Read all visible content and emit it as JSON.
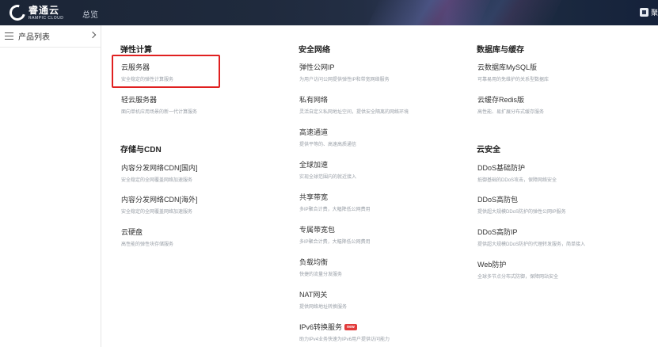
{
  "header": {
    "logo_cn": "睿通云",
    "logo_en": "RAMPIC CLOUD",
    "nav_overview": "总览",
    "user_fragment": "聚"
  },
  "sidebar": {
    "title": "产品列表"
  },
  "columns": [
    {
      "groups": [
        {
          "title": "弹性计算",
          "items": [
            {
              "name": "云服务器",
              "desc": "安全稳定的弹性计算服务"
            },
            {
              "name": "轻云服务器",
              "desc": "面向单机应用场景的新一代计算服务"
            }
          ]
        },
        {
          "title": "存储与CDN",
          "items": [
            {
              "name": "内容分发网络CDN[国内]",
              "desc": "安全稳定的全网覆盖网络加速服务"
            },
            {
              "name": "内容分发网络CDN[海外]",
              "desc": "安全稳定的全网覆盖网络加速服务"
            },
            {
              "name": "云硬盘",
              "desc": "高性能的弹性块存储服务"
            }
          ]
        }
      ]
    },
    {
      "groups": [
        {
          "title": "安全网络",
          "items": [
            {
              "name": "弹性公网IP",
              "desc": "为用户访问公网提供弹性IP和带宽网络服务"
            },
            {
              "name": "私有网络",
              "desc": "灵活自定义私网地址空间，提供安全隔离的网络环境"
            },
            {
              "name": "高速通道",
              "desc": "提供平等的、高速高质通信"
            },
            {
              "name": "全球加速",
              "desc": "实现全球范围内的就近接入"
            },
            {
              "name": "共享带宽",
              "desc": "多IP聚合计费，大幅降低公网费用"
            },
            {
              "name": "专属带宽包",
              "desc": "多IP聚合计费，大幅降低公网费用"
            },
            {
              "name": "负载均衡",
              "desc": "快捷的流量分发服务"
            },
            {
              "name": "NAT网关",
              "desc": "提供网络地址转换服务"
            },
            {
              "name": "IPv6转换服务",
              "desc": "助力IPv4业务快速为IPv6用户提供访问能力",
              "badge": "new"
            }
          ]
        }
      ]
    },
    {
      "groups": [
        {
          "title": "数据库与缓存",
          "items": [
            {
              "name": "云数据库MySQL版",
              "desc": "可靠易用的免维护的关系型数据库"
            },
            {
              "name": "云缓存Redis版",
              "desc": "高性能、易扩展分布式缓存服务"
            }
          ]
        },
        {
          "title": "云安全",
          "items": [
            {
              "name": "DDoS基础防护",
              "desc": "抵御基础的DDoS攻击，保障网络安全"
            },
            {
              "name": "DDoS高防包",
              "desc": "提供超大规模DDoS防护的弹性公网IP服务"
            },
            {
              "name": "DDoS高防IP",
              "desc": "提供超大规模DDoS防护的代理转发服务，简单接入"
            },
            {
              "name": "Web防护",
              "desc": "全球多节点分布式防御，保障网站安全"
            }
          ]
        }
      ]
    }
  ],
  "colors": {
    "highlight": "#e02020",
    "header_bg": "#1b2536",
    "badge": "#e23b3b"
  }
}
